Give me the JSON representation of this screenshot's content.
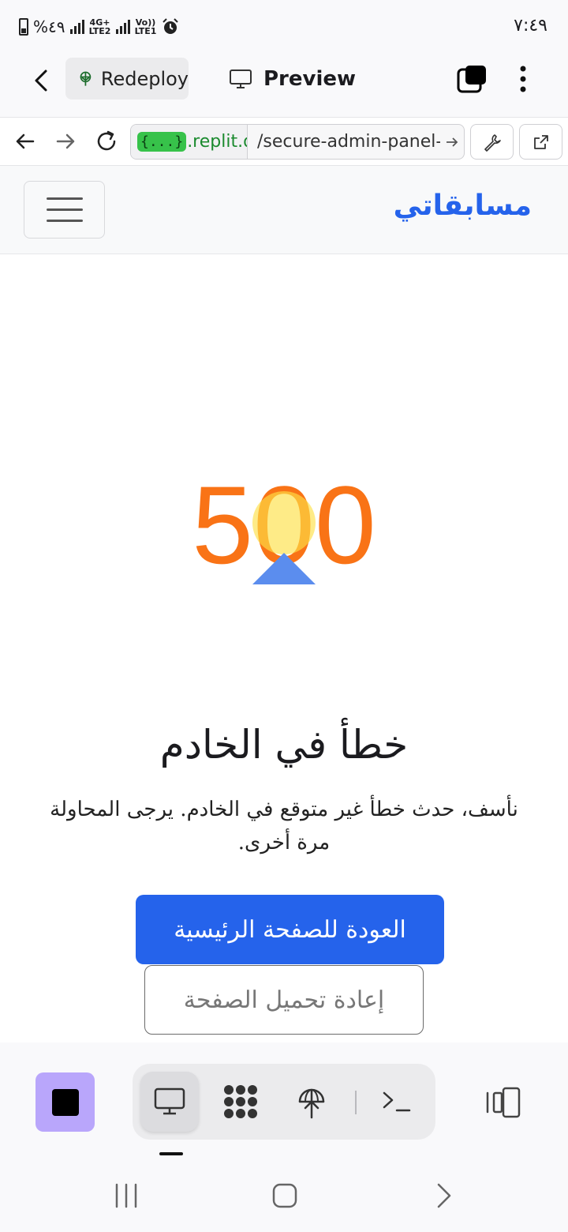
{
  "status_bar": {
    "battery": "%٤٩",
    "network_1": "4G+ LTE2",
    "network_2": "Vo)) LTE1",
    "time": "٧:٤٩"
  },
  "top_bar": {
    "redeploy_label": "Redeploy",
    "preview_label": "Preview"
  },
  "url_bar": {
    "domain_badge": "{...}",
    "domain": ".replit.de",
    "path": "/secure-admin-panel-"
  },
  "site": {
    "brand": "مسابقاتي",
    "error_code": "500",
    "error_title": "خطأ في الخادم",
    "error_message": "نأسف، حدث خطأ غير متوقع في الخادم. يرجى المحاولة مرة أخرى.",
    "home_button": "العودة للصفحة الرئيسية",
    "reload_button": "إعادة تحميل الصفحة"
  },
  "colors": {
    "accent": "#2563eb",
    "error_code": "#f97316",
    "stop_button": "#b9a6fb",
    "domain_badge": "#37c24a"
  },
  "bottom_bar": {
    "items": [
      "preview-icon",
      "workspace-icon",
      "deploy-icon",
      "shell-icon"
    ],
    "active": "preview-icon"
  }
}
